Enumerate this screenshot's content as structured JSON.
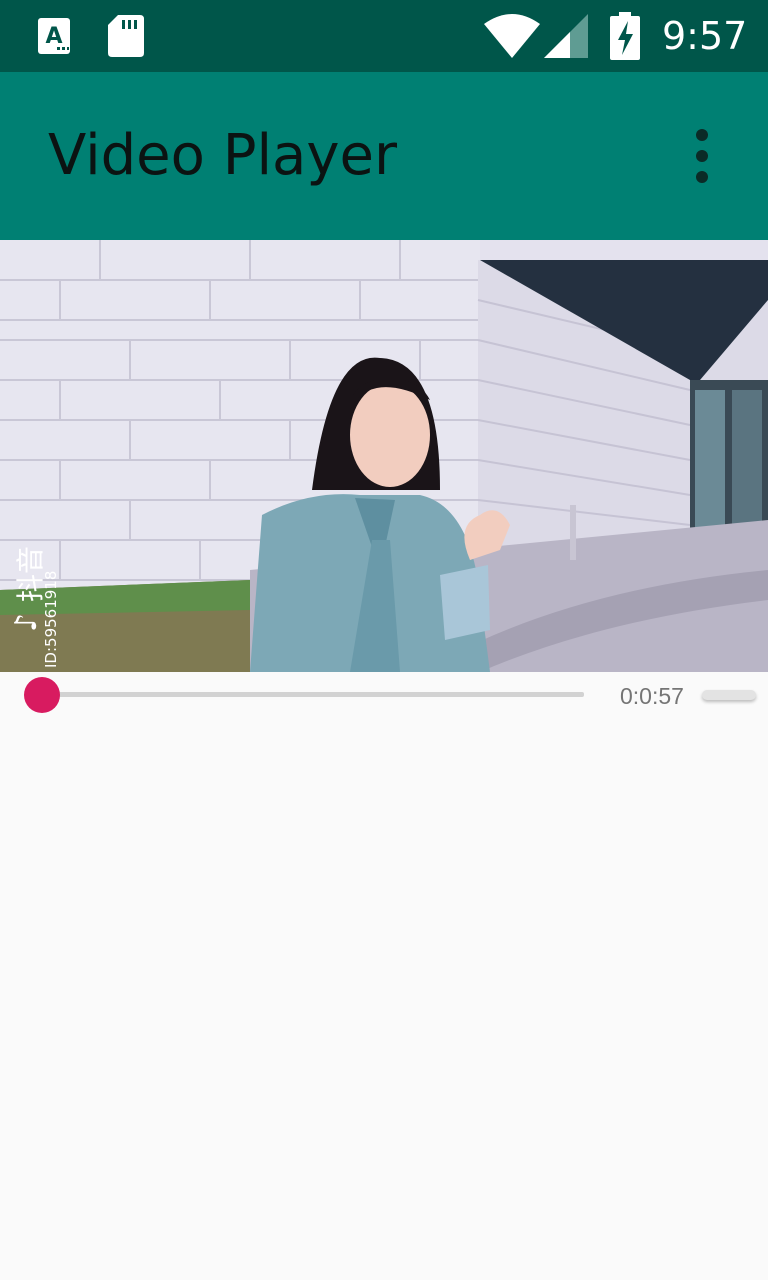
{
  "status_bar": {
    "time": "9:57",
    "icons": [
      "font-a-icon",
      "sd-card-icon",
      "wifi-icon",
      "cell-signal-icon",
      "battery-charging-icon"
    ]
  },
  "app_bar": {
    "title": "Video Player",
    "menu_icon": "more-vert-icon"
  },
  "video": {
    "watermark_brand": "抖音",
    "watermark_id": "ID:59561918"
  },
  "player_controls": {
    "elapsed_time": "0:0:57",
    "progress": 0.0
  },
  "colors": {
    "status_bar": "#00564a",
    "app_bar": "#008073",
    "accent": "#d81b60",
    "background": "#fafafa"
  }
}
